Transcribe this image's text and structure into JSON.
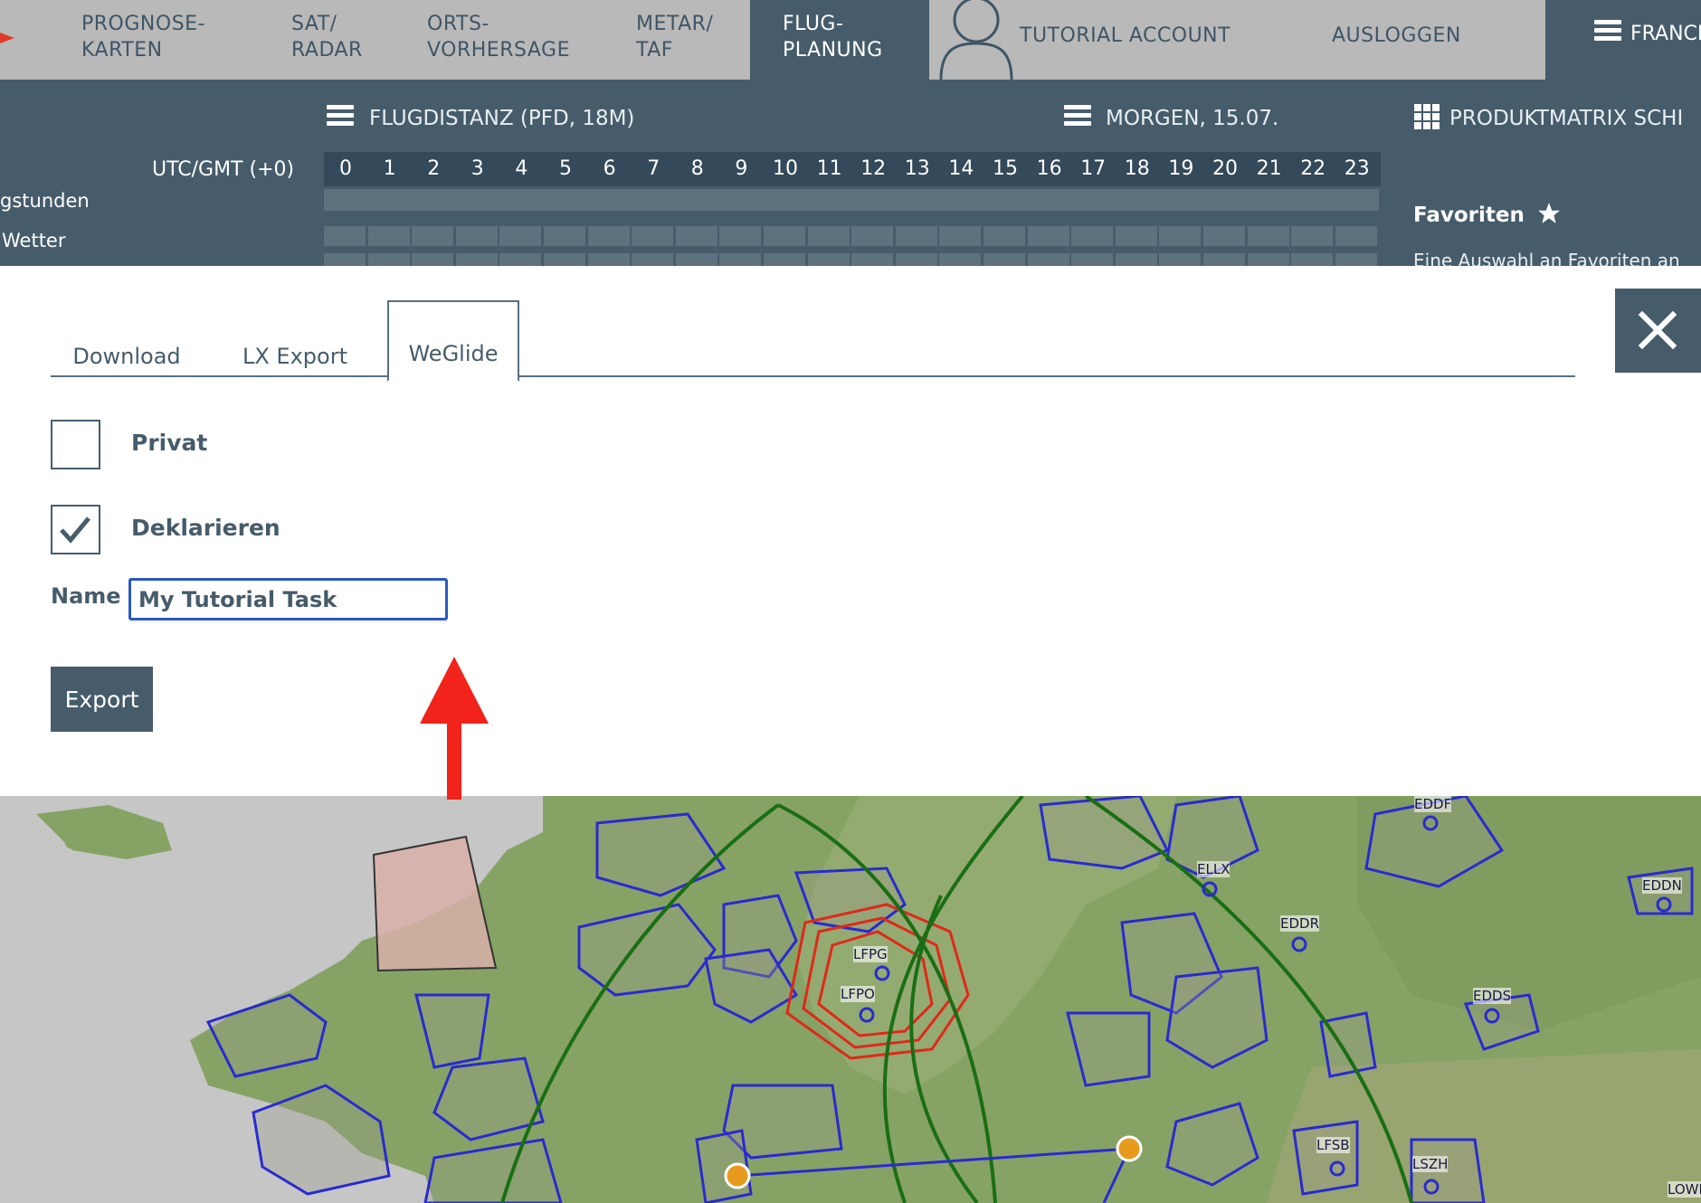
{
  "topnav": {
    "items": [
      {
        "line1": "PROGNOSE-",
        "line2": "KARTEN"
      },
      {
        "line1": "SAT/",
        "line2": "RADAR"
      },
      {
        "line1": "ORTS-",
        "line2": "VORHERSAGE"
      },
      {
        "line1": "METAR/",
        "line2": "TAF"
      },
      {
        "line1": "FLUG-",
        "line2": "PLANUNG"
      }
    ],
    "account": "TUTORIAL ACCOUNT",
    "logout": "AUSLOGGEN",
    "region": "FRANCE"
  },
  "subbar": {
    "flugdistanz": "FLUGDISTANZ (PFD, 18M)",
    "date": "MORGEN, 15.07.",
    "produktmatrix": "PRODUKTMATRIX SCHI",
    "utc_label": "UTC/GMT (+0)",
    "row1": "gstunden",
    "row2": "Wetter",
    "hours": [
      "0",
      "1",
      "2",
      "3",
      "4",
      "5",
      "6",
      "7",
      "8",
      "9",
      "10",
      "11",
      "12",
      "13",
      "14",
      "15",
      "16",
      "17",
      "18",
      "19",
      "20",
      "21",
      "22",
      "23"
    ],
    "favoriten": "Favoriten",
    "favoriten_desc": "Eine Auswahl an Favoriten an"
  },
  "modal": {
    "tabs": [
      "Download",
      "LX Export",
      "WeGlide"
    ],
    "active_tab": "WeGlide",
    "privat_label": "Privat",
    "privat_checked": false,
    "deklarieren_label": "Deklarieren",
    "deklarieren_checked": true,
    "name_label": "Name",
    "name_value": "My Tutorial Task",
    "export_label": "Export"
  },
  "map": {
    "airport_labels": [
      "EDDF",
      "ELLX",
      "EDDR",
      "EDDN",
      "EDDS",
      "LFPG",
      "LFPO",
      "LFSB",
      "LSZH",
      "LOWI"
    ]
  },
  "colors": {
    "header_gray": "#b9b9b9",
    "dark_slate": "#465c6b",
    "input_border": "#2a59c4",
    "arrow_red": "#f2231a",
    "airspace_blue": "#2a2ad0",
    "route_green": "#1a6e14",
    "restricted_red": "#e0281a"
  },
  "icons": [
    "menu-icon",
    "grid-icon",
    "star-icon",
    "user-icon",
    "close-icon",
    "check-icon",
    "arrow-up-icon"
  ]
}
